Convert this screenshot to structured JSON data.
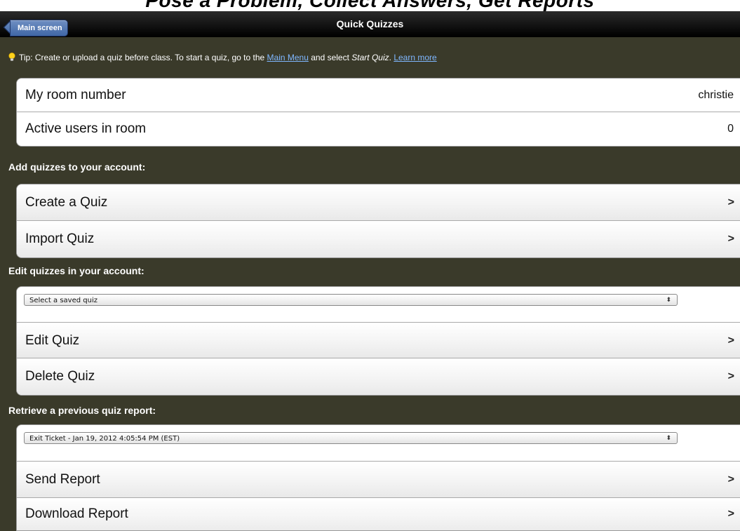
{
  "caption": "Pose a Problem, Collect Answers, Get Reports",
  "navbar": {
    "back_label": "Main screen",
    "title": "Quick Quizzes"
  },
  "tip": {
    "prefix": "Tip: Create or upload a quiz before class. To start a quiz, go to the ",
    "main_menu_link": "Main Menu",
    "middle": " and select ",
    "start_quiz": "Start Quiz",
    "dot": ". ",
    "learn_more_link": "Learn more",
    "icon": "lightbulb-icon"
  },
  "room": {
    "room_number_label": "My room number",
    "room_number_value": "christie",
    "active_users_label": "Active users in room",
    "active_users_value": "0"
  },
  "add_section": {
    "header": "Add quizzes to your account:",
    "create_label": "Create a Quiz",
    "import_label": "Import Quiz"
  },
  "edit_section": {
    "header": "Edit quizzes in your account:",
    "select_value": "Select a saved quiz",
    "edit_label": "Edit Quiz",
    "delete_label": "Delete Quiz"
  },
  "report_section": {
    "header": "Retrieve a previous quiz report:",
    "select_value": "Exit Ticket - Jan 19, 2012 4:05:54 PM (EST)",
    "send_label": "Send Report",
    "download_label": "Download Report"
  },
  "chevron": ">",
  "select_arrow": "⬍",
  "colors": {
    "background": "#3a3a2a",
    "navbar": "#111111",
    "back_button": "#4067a6",
    "link": "#7fb7ff"
  }
}
